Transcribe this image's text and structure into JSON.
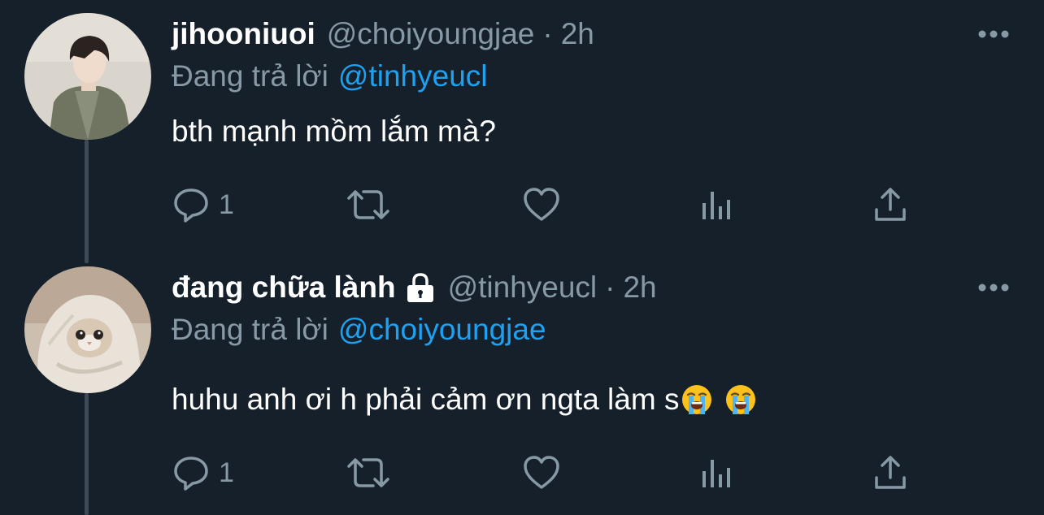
{
  "colors": {
    "background": "#15202b",
    "text_primary": "#ffffff",
    "text_secondary": "#8899a6",
    "mention": "#1da1f2",
    "thread_line": "#3d4a56"
  },
  "tweets": [
    {
      "display_name": "jihooniuoi",
      "handle": "@choiyoungjae",
      "separator": "·",
      "time": "2h",
      "reply_prefix": "Đang trả lời",
      "reply_mention": "@tinhyeucl",
      "text": "bth mạnh mồm lắm mà?",
      "protected": false,
      "emojis": [],
      "reply_count": "1",
      "icons": [
        "reply-icon",
        "retweet-icon",
        "like-icon",
        "analytics-icon",
        "share-icon",
        "more-icon"
      ]
    },
    {
      "display_name": "đang chữa lành",
      "handle": "@tinhyeucl",
      "separator": "·",
      "time": "2h",
      "reply_prefix": "Đang trả lời",
      "reply_mention": "@choiyoungjae",
      "text": "huhu anh ơi h phải cảm ơn ngta làm s",
      "protected": true,
      "emojis": [
        "loudly-crying-face",
        "loudly-crying-face"
      ],
      "reply_count": "1",
      "icons": [
        "lock-icon",
        "reply-icon",
        "retweet-icon",
        "like-icon",
        "analytics-icon",
        "share-icon",
        "more-icon"
      ]
    }
  ]
}
